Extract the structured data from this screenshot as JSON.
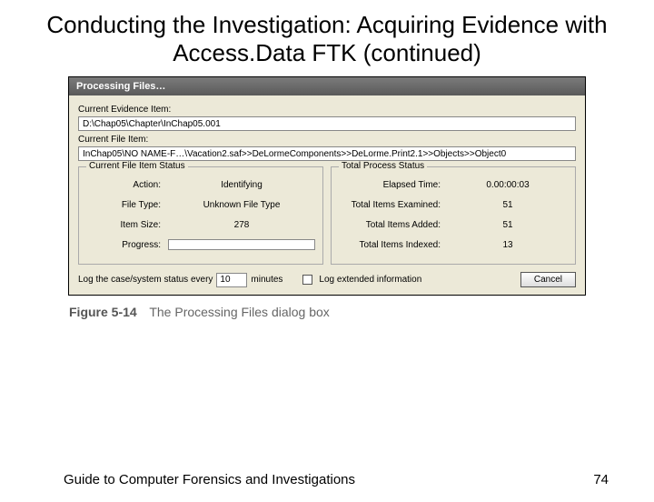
{
  "slide": {
    "title": "Conducting the Investigation: Acquiring Evidence with Access.Data FTK (continued)"
  },
  "dialog": {
    "title": "Processing Files…",
    "evidence_label": "Current Evidence Item:",
    "evidence_value": "D:\\Chap05\\Chapter\\InChap05.001",
    "file_label": "Current File Item:",
    "file_value": "InChap05\\NO NAME-F…\\Vacation2.saf>>DeLormeComponents>>DeLorme.Print2.1>>Objects>>Object0",
    "left_status": {
      "legend": "Current File Item Status",
      "rows": [
        {
          "label": "Action:",
          "value": "Identifying"
        },
        {
          "label": "File Type:",
          "value": "Unknown File Type"
        },
        {
          "label": "Item Size:",
          "value": "278"
        }
      ],
      "progress_label": "Progress:"
    },
    "right_status": {
      "legend": "Total Process Status",
      "rows": [
        {
          "label": "Elapsed Time:",
          "value": "0.00:00:03"
        },
        {
          "label": "Total Items Examined:",
          "value": "51"
        },
        {
          "label": "Total Items Added:",
          "value": "51"
        },
        {
          "label": "Total Items Indexed:",
          "value": "13"
        }
      ]
    },
    "log_prefix": "Log the case/system status every",
    "log_value": "10",
    "log_suffix": "minutes",
    "log_extended": "Log extended information",
    "cancel": "Cancel"
  },
  "figure": {
    "number": "Figure 5-14",
    "caption": "The Processing Files dialog box"
  },
  "footer": {
    "left": "Guide to Computer Forensics and Investigations",
    "right": "74"
  }
}
